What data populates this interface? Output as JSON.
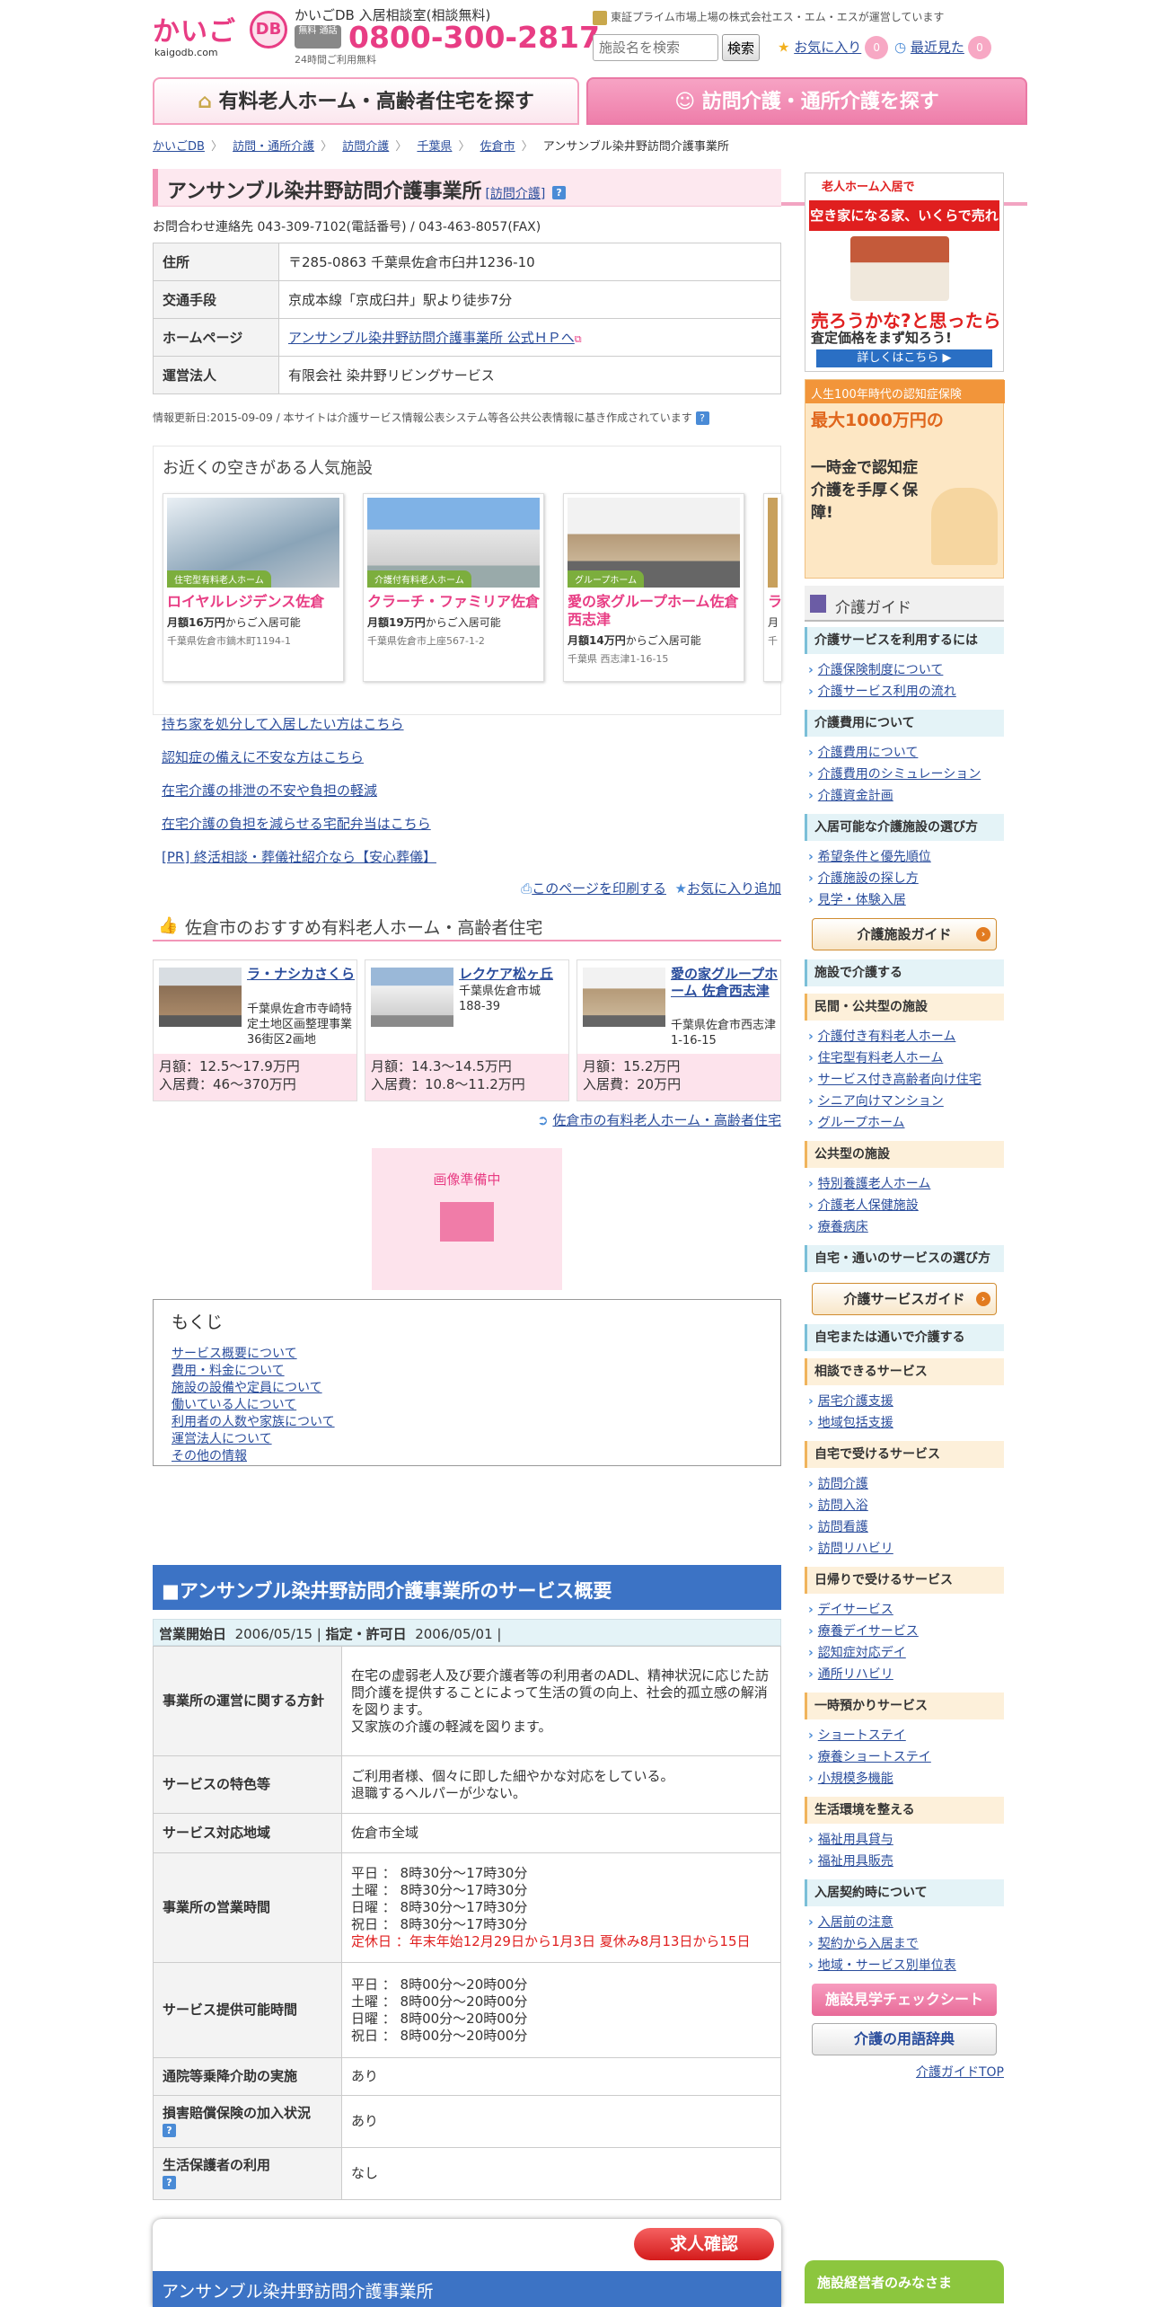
{
  "header": {
    "logo_main": "かいご",
    "logo_db": "DB",
    "logo_url": "kaigodb.com",
    "tel_title": "かいごDB 入居相談室(相談無料)",
    "tel_badge": "無料 通話",
    "tel_number": "0800-300-2817",
    "tel_hours": "24時間ご利用無料",
    "corp_text": "東証プライム市場上場の株式会社エス・エム・エスが運営しています",
    "search_placeholder": "施設名を検索",
    "search_button": "検索",
    "favorites_label": "お気に入り",
    "favorites_count": "0",
    "recent_label": "最近見た",
    "recent_count": "0"
  },
  "tabs": [
    {
      "label": "有料老人ホーム・高齢者住宅を探す"
    },
    {
      "label": "訪問介護・通所介護を探す"
    }
  ],
  "breadcrumb": [
    "かいごDB",
    "訪問・通所介護",
    "訪問介護",
    "千葉県",
    "佐倉市",
    "アンサンブル染井野訪問介護事業所"
  ],
  "facility": {
    "name": "アンサンブル染井野訪問介護事業所",
    "category_link": "[訪問介護]",
    "contact": "お問合わせ連絡先 043-309-7102(電話番号) / 043-463-8057(FAX)",
    "rows": [
      {
        "label": "住所",
        "value": "〒285-0863 千葉県佐倉市臼井1236-10"
      },
      {
        "label": "交通手段",
        "value": "京成本線「京成臼井」駅より徒歩7分"
      },
      {
        "label": "ホームページ",
        "value": "アンサンブル染井野訪問介護事業所 公式ＨＰへ"
      },
      {
        "label": "運営法人",
        "value": "有限会社 染井野リビングサービス"
      }
    ],
    "updated": "情報更新日:2015-09-09 / 本サイトは介護サービス情報公表システム等各公共公表情報に基き作成されています"
  },
  "nearby": {
    "title": "お近くの空きがある人気施設",
    "cards": [
      {
        "category": "住宅型有料老人ホーム",
        "name": "ロイヤルレジデンス佐倉",
        "price_amount": "月額16万円",
        "price_suffix": "からご入居可能",
        "address": "千葉県佐倉市鏑木町1194-1"
      },
      {
        "category": "介護付有料老人ホーム",
        "name": "クラーチ・ファミリア佐倉",
        "price_amount": "月額19万円",
        "price_suffix": "からご入居可能",
        "address": "千葉県佐倉市上座567-1-2"
      },
      {
        "category": "グループホーム",
        "name": "愛の家グループホーム佐倉西志津",
        "price_amount": "月額14万円",
        "price_suffix": "からご入居可能",
        "address": "千葉県 西志津1-16-15"
      },
      {
        "category": "",
        "name": "ラ",
        "price_amount": "月",
        "price_suffix": "",
        "address": "千"
      }
    ]
  },
  "promo_links": [
    "持ち家を処分して入居したい方はこちら",
    "認知症の備えに不安な方はこちら",
    "在宅介護の排泄の不安や負担の軽減",
    "在宅介護の負担を減らせる宅配弁当はこちら",
    "[PR] 終活相談・葬儀社紹介なら【安心葬儀】"
  ],
  "actions": {
    "print": "このページを印刷する",
    "favorite": "お気に入り追加"
  },
  "recommend": {
    "title": "佐倉市のおすすめ有料老人ホーム・高齢者住宅",
    "items": [
      {
        "name": "ラ・ナシカさくら",
        "address": "千葉県佐倉市寺崎特定土地区画整理事業36街区2画地",
        "monthly": "月額：12.5～17.9万円",
        "entry": "入居費：46～370万円"
      },
      {
        "name": "レクケア松ヶ丘",
        "address": "千葉県佐倉市城188-39",
        "monthly": "月額：14.3～14.5万円",
        "entry": "入居費：10.8～11.2万円"
      },
      {
        "name": "愛の家グループホーム 佐倉西志津",
        "address": "千葉県佐倉市西志津1-16-15",
        "monthly": "月額：15.2万円",
        "entry": "入居費：20万円"
      }
    ],
    "more": "佐倉市の有料老人ホーム・高齢者住宅"
  },
  "noimage": "画像準備中",
  "toc": {
    "title": "もくじ",
    "items": [
      "サービス概要について",
      "費用・料金について",
      "施設の設備や定員について",
      "働いている人について",
      "利用者の人数や家族について",
      "運営法人について",
      "その他の情報"
    ]
  },
  "service": {
    "heading": "■アンサンブル染井野訪問介護事業所のサービス概要",
    "start_label": "営業開始日",
    "start_value": "2006/05/15",
    "permit_label": "指定・許可日",
    "permit_value": "2006/05/01",
    "rows": [
      {
        "label": "事業所の運営に関する方針",
        "lines": [
          "在宅の虚弱老人及び要介護者等の利用者のADL、精神状況に応じた訪問介護を提供することによって生活の質の向上、社会的孤立感の解消を図ります。",
          "又家族の介護の軽減を図ります。"
        ]
      },
      {
        "label": "サービスの特色等",
        "lines": [
          "ご利用者様、個々に即した細やかな対応をしている。",
          "退職するヘルパーが少ない。"
        ]
      },
      {
        "label": "サービス対応地域",
        "lines": [
          "佐倉市全域"
        ]
      },
      {
        "label": "事業所の営業時間",
        "lines": [
          "平日 ： 8時30分～17時30分",
          "土曜 ： 8時30分～17時30分",
          "日曜 ： 8時30分～17時30分",
          "祝日 ： 8時30分～17時30分"
        ],
        "note": "定休日 ：年末年始12月29日から1月3日 夏休み8月13日から15日"
      },
      {
        "label": "サービス提供可能時間",
        "lines": [
          "平日 ： 8時00分～20時00分",
          "土曜 ： 8時00分～20時00分",
          "日曜 ： 8時00分～20時00分",
          "祝日 ： 8時00分～20時00分"
        ]
      },
      {
        "label": "通院等乗降介助の実施",
        "lines": [
          "あり"
        ]
      },
      {
        "label": "損害賠償保険の加入状況",
        "lines": [
          "あり"
        ]
      },
      {
        "label": "生活保護者の利用",
        "lines": [
          "なし"
        ]
      }
    ]
  },
  "recruit": {
    "button": "求人確認",
    "name": "アンサンブル染井野訪問介護事業所"
  },
  "sidebar": {
    "ad1": {
      "top": "老人ホーム入居で",
      "banner": "空き家になる家、いくらで売れる?",
      "main": "売ろうかな?と思ったら",
      "sub": "査定価格をまず知ろう!",
      "button": "詳しくはこちら ▶"
    },
    "ad2": {
      "top": "人生100年時代の認知症保険",
      "line1": "最大1000万円の",
      "line2": "一時金で認知症介護を手厚く保障!"
    },
    "guide_title": "介護ガイド",
    "sections": [
      {
        "heading": "介護サービスを利用するには",
        "style": "blue",
        "links": [
          "介護保険制度について",
          "介護サービス利用の流れ"
        ]
      },
      {
        "heading": "介護費用について",
        "style": "blue",
        "links": [
          "介護費用について",
          "介護費用のシミュレーション",
          "介護資金計画"
        ]
      },
      {
        "heading": "入居可能な介護施設の選び方",
        "style": "blue",
        "links": [
          "希望条件と優先順位",
          "介護施設の探し方",
          "見学・体験入居"
        ],
        "button": "介護施設ガイド"
      },
      {
        "heading": "施設で介護する",
        "style": "blue",
        "links": []
      },
      {
        "heading": "民間・公共型の施設",
        "style": "yellow",
        "links": [
          "介護付き有料老人ホーム",
          "住宅型有料老人ホーム",
          "サービス付き高齢者向け住宅",
          "シニア向けマンション",
          "グループホーム"
        ]
      },
      {
        "heading": "公共型の施設",
        "style": "yellow",
        "links": [
          "特別養護老人ホーム",
          "介護老人保健施設",
          "療養病床"
        ]
      },
      {
        "heading": "自宅・通いのサービスの選び方",
        "style": "blue",
        "links": [],
        "button": "介護サービスガイド"
      },
      {
        "heading": "自宅または通いで介護する",
        "style": "blue",
        "links": []
      },
      {
        "heading": "相談できるサービス",
        "style": "yellow",
        "links": [
          "居宅介護支援",
          "地域包括支援"
        ]
      },
      {
        "heading": "自宅で受けるサービス",
        "style": "yellow",
        "links": [
          "訪問介護",
          "訪問入浴",
          "訪問看護",
          "訪問リハビリ"
        ]
      },
      {
        "heading": "日帰りで受けるサービス",
        "style": "yellow",
        "links": [
          "デイサービス",
          "療養デイサービス",
          "認知症対応デイ",
          "通所リハビリ"
        ]
      },
      {
        "heading": "一時預かりサービス",
        "style": "yellow",
        "links": [
          "ショートステイ",
          "療養ショートステイ",
          "小規模多機能"
        ]
      },
      {
        "heading": "生活環境を整える",
        "style": "yellow",
        "links": [
          "福祉用具貸与",
          "福祉用具販売"
        ]
      },
      {
        "heading": "入居契約時について",
        "style": "blue",
        "links": [
          "入居前の注意",
          "契約から入居まで",
          "地域・サービス別単位表"
        ]
      }
    ],
    "checksheet": "施設見学チェックシート",
    "dictionary": "介護の用語辞典",
    "guide_top": "介護ガイドTOP",
    "owners": "施設経営者のみなさま"
  }
}
